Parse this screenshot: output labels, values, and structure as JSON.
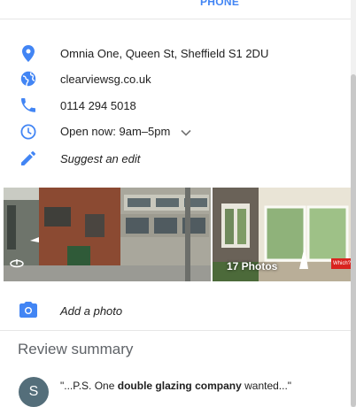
{
  "header": {
    "phone_tab": "PHONE"
  },
  "info": {
    "address": "Omnia One, Queen St, Sheffield S1 2DU",
    "website": "clearviewsg.co.uk",
    "phone": "0114 294 5018",
    "hours": "Open now:  9am–5pm",
    "suggest_edit": "Suggest an edit"
  },
  "photos": {
    "count_label": "17 Photos",
    "badge": "Which?"
  },
  "add_photo": {
    "label": "Add a photo"
  },
  "reviews": {
    "title": "Review summary",
    "items": [
      {
        "avatar_initial": "S",
        "prefix": "\"...P.S. One ",
        "highlight": "double glazing company",
        "suffix": " wanted...\""
      }
    ]
  },
  "colors": {
    "accent": "#4285f4",
    "avatar": "#546e7a",
    "muted": "#5f6368"
  }
}
